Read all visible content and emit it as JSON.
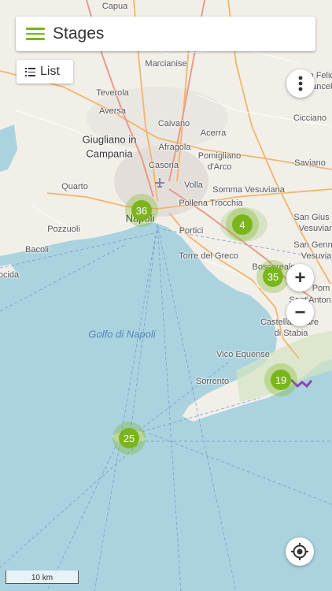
{
  "header": {
    "title": "Stages",
    "menu_icon": "hamburger-icon"
  },
  "list_button": {
    "label": "List",
    "icon": "list-icon"
  },
  "controls": {
    "more_icon": "more-vertical-icon",
    "zoom_in": "+",
    "zoom_out": "−",
    "locate_icon": "locate-icon"
  },
  "clusters": [
    "36",
    "4",
    "35",
    "19",
    "25"
  ],
  "places": {
    "capua": "Capua",
    "marcianise": "Marcianise",
    "teverola": "Teverola",
    "aversa": "Aversa",
    "caivano": "Caivano",
    "acerra": "Acerra",
    "giugliano": "Giugliano in",
    "campania": "Campania",
    "afragola": "Afragola",
    "pomigliano": "Pomigliano",
    "darco": "d'Arco",
    "casoria": "Casoria",
    "quarto": "Quarto",
    "volla": "Volla",
    "somma": "Somma Vesuviana",
    "pollena": "Pollena Trocchia",
    "napoli": "Napoli",
    "pozzuoli": "Pozzuoli",
    "portici": "Portici",
    "bacoli": "Bacoli",
    "torre": "Torre del Greco",
    "boscoreale": "Boscoreale",
    "santanton": "Sant'Anton",
    "gioco": "ocida",
    "golfo": "Golfo di Napoli",
    "castellammare": "Castellammare",
    "stabia": "di Stabia",
    "vico": "Vico Equense",
    "sorrento": "Sorrento",
    "cicciano": "Cicciano",
    "saviano": "Saviano",
    "sanfelice": "San Felic",
    "acancello": "a Cancell",
    "sangiuseppe": "San Gius",
    "vesuviano": "Vesuvian",
    "sangennaro": "San Genn",
    "vesuviano2": "Vesuvia",
    "pompei": "Pom",
    "nola": "N"
  },
  "scale": {
    "label": "10 km"
  },
  "colors": {
    "accent": "#7ab51d",
    "sea": "#aad3df",
    "land": "#f2efe9",
    "route": "#8e44ad"
  }
}
